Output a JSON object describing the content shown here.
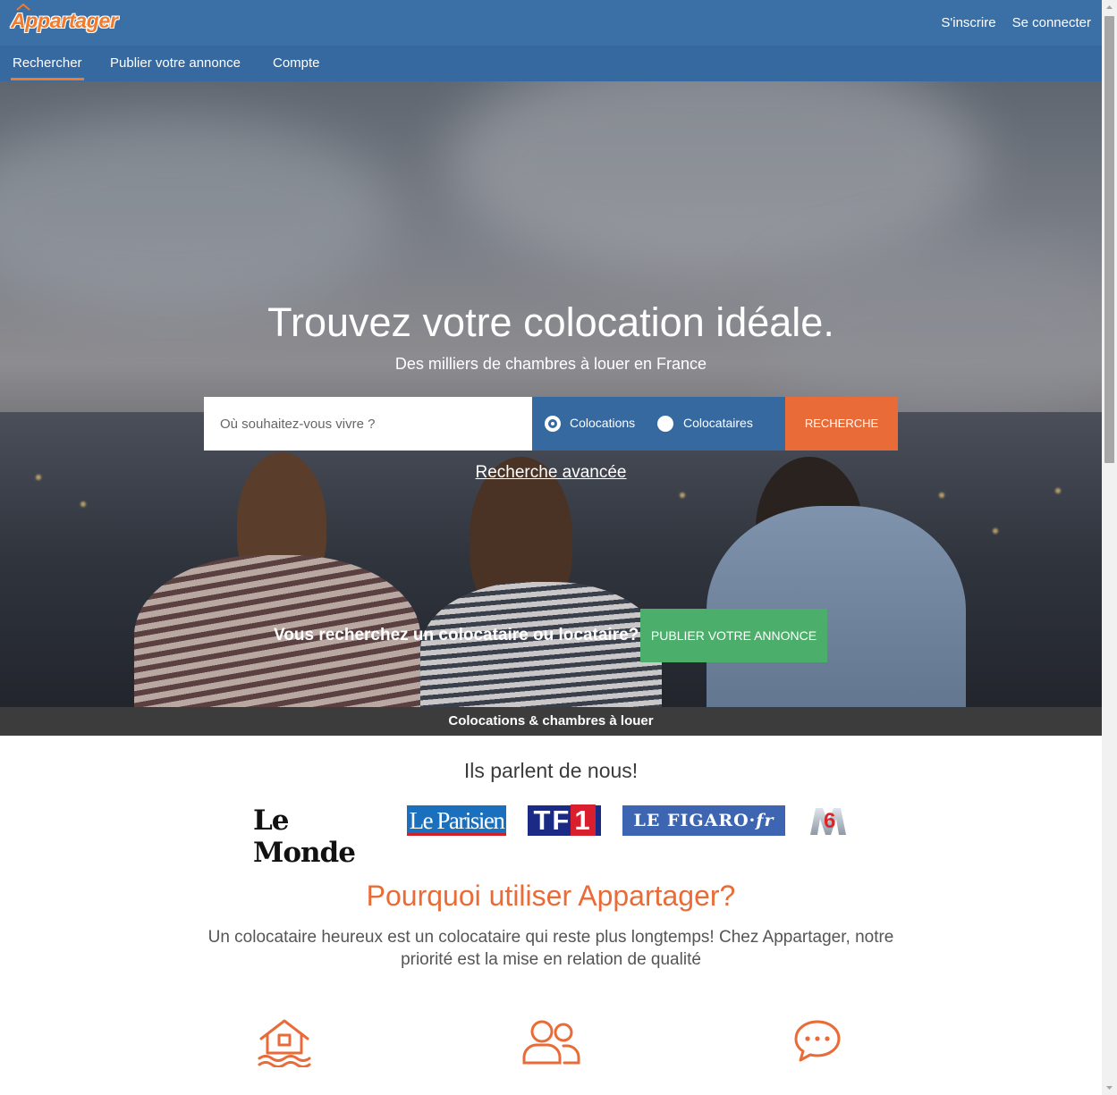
{
  "header": {
    "logo_text": "Appartager",
    "signup_label": "S'inscrire",
    "login_label": "Se connecter"
  },
  "nav": {
    "tabs": [
      {
        "label": "Rechercher",
        "active": true
      },
      {
        "label": "Publier votre annonce",
        "active": false
      },
      {
        "label": "Compte",
        "active": false
      }
    ]
  },
  "hero": {
    "title": "Trouvez votre colocation idéale.",
    "subtitle": "Des milliers de chambres à louer en France",
    "search": {
      "placeholder": "Où souhaitez-vous vivre ?",
      "value": "",
      "options": [
        {
          "label": "Colocations",
          "checked": true
        },
        {
          "label": "Colocataires",
          "checked": false
        }
      ],
      "button_label": "RECHERCHE"
    },
    "advanced_search_label": "Recherche avancée",
    "cta_text": "Vous recherchez un colocataire ou locataire?",
    "cta_button_label": "PUBLIER VOTRE ANNONCE"
  },
  "strip_label": "Colocations & chambres à louer",
  "press": {
    "title": "Ils parlent de nous!",
    "logos": [
      "Le Monde",
      "Le Parisien",
      "TF1",
      "LE FIGARO·fr",
      "M6"
    ]
  },
  "why": {
    "title": "Pourquoi utiliser Appartager?",
    "text": "Un colocataire heureux est un colocataire qui reste plus longtemps! Chez Appartager, notre priorité est la mise en relation de qualité"
  },
  "features": {
    "icons": [
      "house-icon",
      "people-icon",
      "chat-icon"
    ]
  },
  "colors": {
    "header_blue": "#3a70a6",
    "accent_orange": "#e96b38",
    "cta_green": "#4cae6b",
    "strip_dark": "#3c3c3c"
  }
}
